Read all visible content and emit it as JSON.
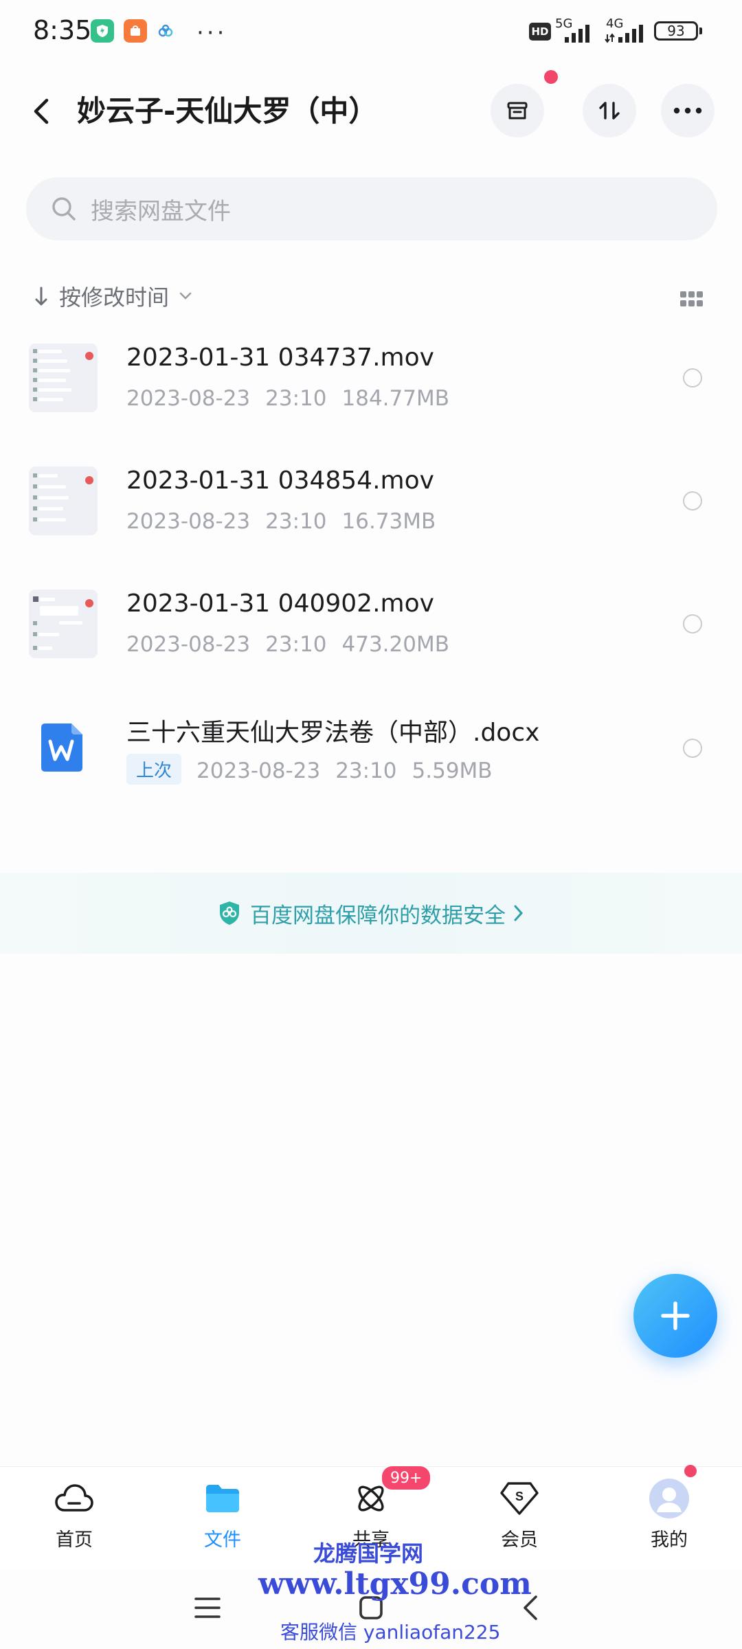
{
  "status_bar": {
    "time": "8:35",
    "more": "···",
    "hd": "HD",
    "network_1": "5G",
    "network_2": "4G",
    "battery": "93"
  },
  "header": {
    "title": "妙云子-天仙大罗（中）"
  },
  "search": {
    "placeholder": "搜索网盘文件"
  },
  "sort": {
    "label": "按修改时间"
  },
  "files": [
    {
      "name": "2023-01-31 034737.mov",
      "date": "2023-08-23",
      "time": "23:10",
      "size": "184.77MB",
      "tag": ""
    },
    {
      "name": "2023-01-31 034854.mov",
      "date": "2023-08-23",
      "time": "23:10",
      "size": "16.73MB",
      "tag": ""
    },
    {
      "name": "2023-01-31 040902.mov",
      "date": "2023-08-23",
      "time": "23:10",
      "size": "473.20MB",
      "tag": ""
    },
    {
      "name": "三十六重天仙大罗法卷（中部）.docx",
      "date": "2023-08-23",
      "time": "23:10",
      "size": "5.59MB",
      "tag": "上次"
    }
  ],
  "security_banner": {
    "text": "百度网盘保障你的数据安全"
  },
  "bottom_nav": {
    "items": [
      {
        "label": "首页",
        "icon": "cloud-icon"
      },
      {
        "label": "文件",
        "icon": "folder-icon",
        "active": true
      },
      {
        "label": "共享",
        "icon": "atom-icon",
        "badge": "99+"
      },
      {
        "label": "会员",
        "icon": "vip-diamond-icon"
      },
      {
        "label": "我的",
        "icon": "avatar-icon"
      }
    ]
  },
  "watermark": {
    "title": "龙腾国学网",
    "url": "www.ltgx99.com",
    "contact": "客服微信 yanliaofan225"
  },
  "colors": {
    "accent": "#1e8fff",
    "badge": "#f5476d",
    "security": "#2e9fa8"
  }
}
